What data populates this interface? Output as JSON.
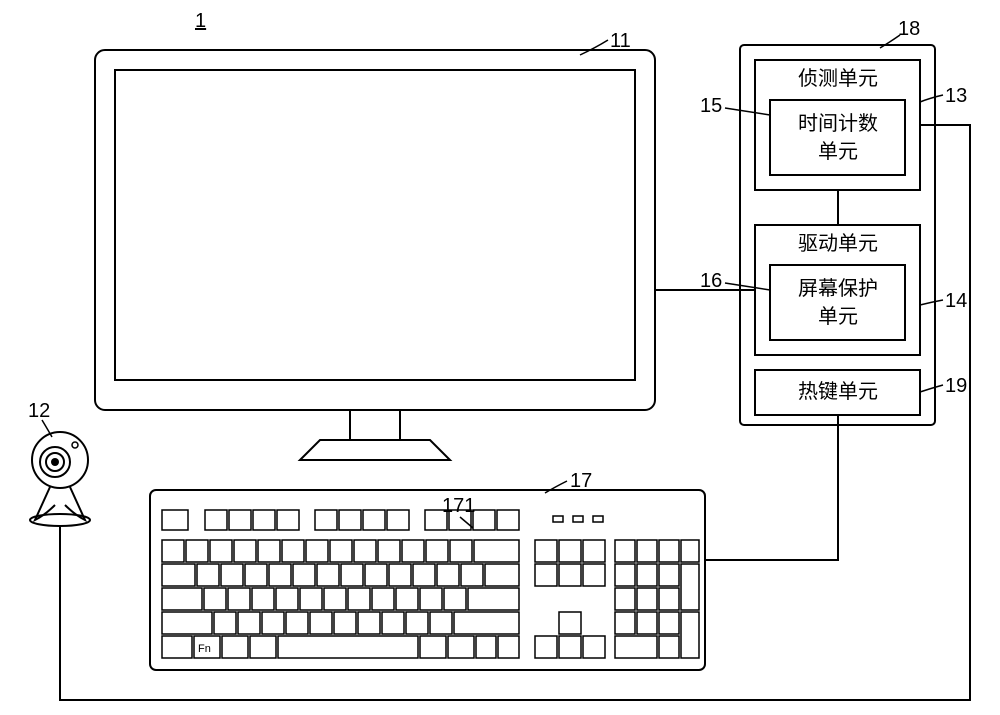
{
  "refs": {
    "system": "1",
    "monitor": "11",
    "camera": "12",
    "detect_unit_ref": "13",
    "drive_unit_ref": "14",
    "time_unit_ref": "15",
    "screen_unit_ref": "16",
    "keyboard": "17",
    "fn_key": "171",
    "outer_module": "18",
    "hotkey_unit_ref": "19"
  },
  "boxes": {
    "detect_unit": "侦测单元",
    "time_unit_l1": "时间计数",
    "time_unit_l2": "单元",
    "drive_unit": "驱动单元",
    "screen_unit_l1": "屏幕保护",
    "screen_unit_l2": "单元",
    "hotkey_unit": "热键单元"
  },
  "keys": {
    "fn": "Fn"
  }
}
